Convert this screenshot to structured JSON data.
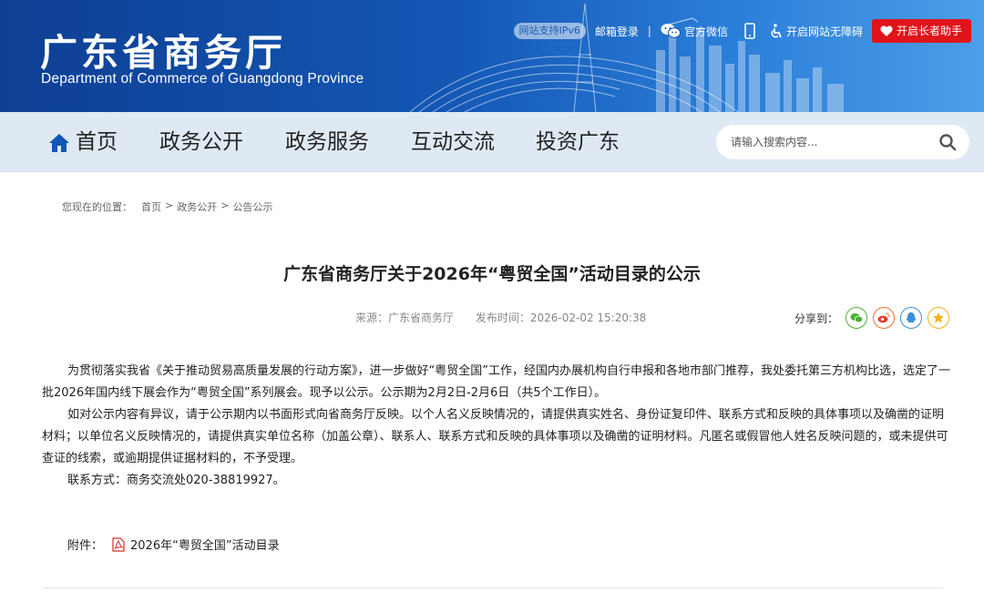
{
  "header": {
    "title": "广东省商务厅",
    "subtitle": "Department of Commerce of Guangdong Province",
    "ipv6_badge": "网站支持IPv6",
    "mail_login": "邮箱登录",
    "separator": "|",
    "wechat": "官方微信",
    "accessibility": "开启网站无障碍",
    "elder_assistant": "开启长者助手"
  },
  "nav": {
    "items": [
      {
        "label": "首页"
      },
      {
        "label": "政务公开"
      },
      {
        "label": "政务服务"
      },
      {
        "label": "互动交流"
      },
      {
        "label": "投资广东"
      }
    ],
    "search_placeholder": "请输入搜索内容..."
  },
  "breadcrumb": {
    "label": "您现在的位置：",
    "items": [
      "首页",
      "政务公开",
      "公告公示"
    ],
    "separator": ">"
  },
  "article": {
    "title": "广东省商务厅关于2026年“粤贸全国”活动目录的公示",
    "source": "来源：广东省商务厅",
    "publish_time": "发布时间：2026-02-02 15:20:38",
    "share_label": "分享到：",
    "share_icons": [
      "wechat-icon",
      "weibo-icon",
      "qq-icon",
      "qzone-icon"
    ],
    "paragraphs": [
      "为贯彻落实我省《关于推动贸易高质量发展的行动方案》，进一步做好“粤贸全国”工作，经国内办展机构自行申报和各地市部门推荐，我处委托第三方机构比选，选定了一批2026年国内线下展会作为“粤贸全国”系列展会。现予以公示。公示期为2月2日-2月6日（共5个工作日）。",
      "如对公示内容有异议，请于公示期内以书面形式向省商务厅反映。以个人名义反映情况的，请提供真实姓名、身份证复印件、联系方式和反映的具体事项以及确凿的证明材料；以单位名义反映情况的，请提供真实单位名称（加盖公章）、联系人、联系方式和反映的具体事项以及确凿的证明材料。凡匿名或假冒他人姓名反映问题的，或未提供可查证的线索，或逾期提供证据材料的，不予受理。",
      "联系方式：商务交流处020-38819927。"
    ],
    "attachment_label": "附件：",
    "attachment_name": "2026年“粤贸全国”活动目录"
  },
  "colors": {
    "banner_dark": "#0e3f93",
    "banner_light": "#4d9ee8",
    "nav_bg": "#dfe9f4",
    "elder_red": "#e0141b",
    "wechat_green": "#4cb034",
    "weibo_orange": "#f06e2b",
    "qq_blue": "#3a8fd8",
    "qzone_yellow": "#f2b318"
  }
}
